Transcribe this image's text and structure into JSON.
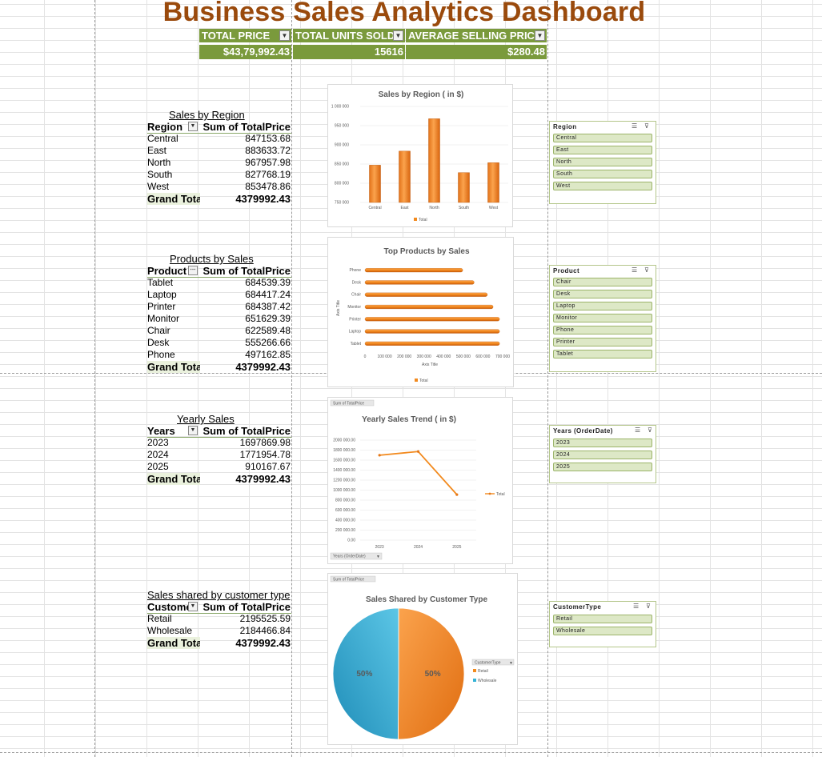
{
  "title": "Business Sales Analytics Dashboard",
  "kpis": [
    {
      "label": "TOTAL PRICE",
      "value": "$43,79,992.43"
    },
    {
      "label": "TOTAL UNITS SOLD",
      "value": "15616"
    },
    {
      "label": "AVERAGE SELLING PRICE",
      "value": "$280.48"
    }
  ],
  "pivots": {
    "region": {
      "title": "Sales by Region",
      "headers": [
        "Region",
        "Sum of TotalPrice"
      ],
      "rows": [
        [
          "Central",
          "847153.68"
        ],
        [
          "East",
          "883633.72"
        ],
        [
          "North",
          "967957.98"
        ],
        [
          "South",
          "827768.19"
        ],
        [
          "West",
          "853478.86"
        ]
      ],
      "total": [
        "Grand Total",
        "4379992.43"
      ]
    },
    "products": {
      "title": "Products by Sales",
      "headers": [
        "Product",
        "Sum of TotalPrice"
      ],
      "rows": [
        [
          "Tablet",
          "684539.39"
        ],
        [
          "Laptop",
          "684417.24"
        ],
        [
          "Printer",
          "684387.42"
        ],
        [
          "Monitor",
          "651629.39"
        ],
        [
          "Chair",
          "622589.48"
        ],
        [
          "Desk",
          "555266.66"
        ],
        [
          "Phone",
          "497162.85"
        ]
      ],
      "total": [
        "Grand Total",
        "4379992.43"
      ]
    },
    "yearly": {
      "title": "Yearly Sales",
      "headers": [
        "Years",
        "Sum of TotalPrice"
      ],
      "rows": [
        [
          "2023",
          "1697869.98"
        ],
        [
          "2024",
          "1771954.78"
        ],
        [
          "2025",
          "910167.67"
        ]
      ],
      "total": [
        "Grand Total",
        "4379992.43"
      ]
    },
    "customer": {
      "title": "Sales shared by customer type",
      "headers": [
        "CustomerType",
        "Sum of TotalPrice"
      ],
      "rows": [
        [
          "Retail",
          "2195525.59"
        ],
        [
          "Wholesale",
          "2184466.84"
        ]
      ],
      "total": [
        "Grand Total",
        "4379992.43"
      ]
    }
  },
  "chart_data": [
    {
      "type": "bar",
      "title": "Sales by Region ( in $)",
      "categories": [
        "Central",
        "East",
        "North",
        "South",
        "West"
      ],
      "values": [
        847153.68,
        883633.72,
        967957.98,
        827768.19,
        853478.86
      ],
      "ylim": [
        750000,
        1000000
      ],
      "yticks": [
        "750 000",
        "800 000",
        "850 000",
        "900 000",
        "950 000",
        "1 000 000"
      ],
      "legend": "Total",
      "legend_position": "bottom",
      "grid": true,
      "color": "#f28a1e"
    },
    {
      "type": "bar",
      "orientation": "horizontal",
      "title": "Top Products by Sales",
      "categories": [
        "Tablet",
        "Laptop",
        "Printer",
        "Monitor",
        "Chair",
        "Desk",
        "Phone"
      ],
      "values": [
        684539.39,
        684417.24,
        684387.42,
        651629.39,
        622589.48,
        555266.66,
        497162.85
      ],
      "xlim": [
        0,
        700000
      ],
      "xticks": [
        "0",
        "100 000",
        "200 000",
        "300 000",
        "400 000",
        "500 000",
        "600 000",
        "700 000"
      ],
      "xlabel": "Axis Title",
      "ylabel": "Axis Title",
      "legend": "Total",
      "legend_position": "bottom",
      "color": "#f28a1e"
    },
    {
      "type": "line",
      "title": "Yearly Sales Trend ( in $)",
      "field_button": "Sum of TotalPrice",
      "axis_button": "Years (OrderDate)",
      "x": [
        "2023",
        "2024",
        "2025"
      ],
      "values": [
        1697869.98,
        1771954.78,
        910167.67
      ],
      "ylim": [
        0,
        2000000
      ],
      "yticks": [
        "0.00",
        "200 000.00",
        "400 000.00",
        "600 000.00",
        "800 000.00",
        "1000 000.00",
        "1200 000.00",
        "1400 000.00",
        "1600 000.00",
        "1800 000.00",
        "2000 000.00"
      ],
      "legend": "Total",
      "legend_position": "right",
      "grid": true,
      "color": "#f28a1e"
    },
    {
      "type": "pie",
      "title": "Sales Shared by Customer Type",
      "field_button": "Sum of TotalPrice",
      "legend_title": "CustomerType",
      "labels": [
        "Retail",
        "Wholesale"
      ],
      "values": [
        2195525.59,
        2184466.84
      ],
      "percent_labels": [
        "50%",
        "50%"
      ],
      "colors": [
        "#f28a1e",
        "#35b3d6"
      ],
      "legend_position": "right"
    }
  ],
  "slicers": [
    {
      "title": "Region",
      "items": [
        "Central",
        "East",
        "North",
        "South",
        "West"
      ]
    },
    {
      "title": "Product",
      "items": [
        "Chair",
        "Desk",
        "Laptop",
        "Monitor",
        "Phone",
        "Printer",
        "Tablet"
      ]
    },
    {
      "title": "Years (OrderDate)",
      "items": [
        "2023",
        "2024",
        "2025"
      ]
    },
    {
      "title": "CustomerType",
      "items": [
        "Retail",
        "Wholesale"
      ]
    }
  ],
  "icons": {
    "multi_select": "multi-select-icon",
    "clear_filter": "clear-filter-icon",
    "dropdown": "dropdown-arrow-icon"
  }
}
